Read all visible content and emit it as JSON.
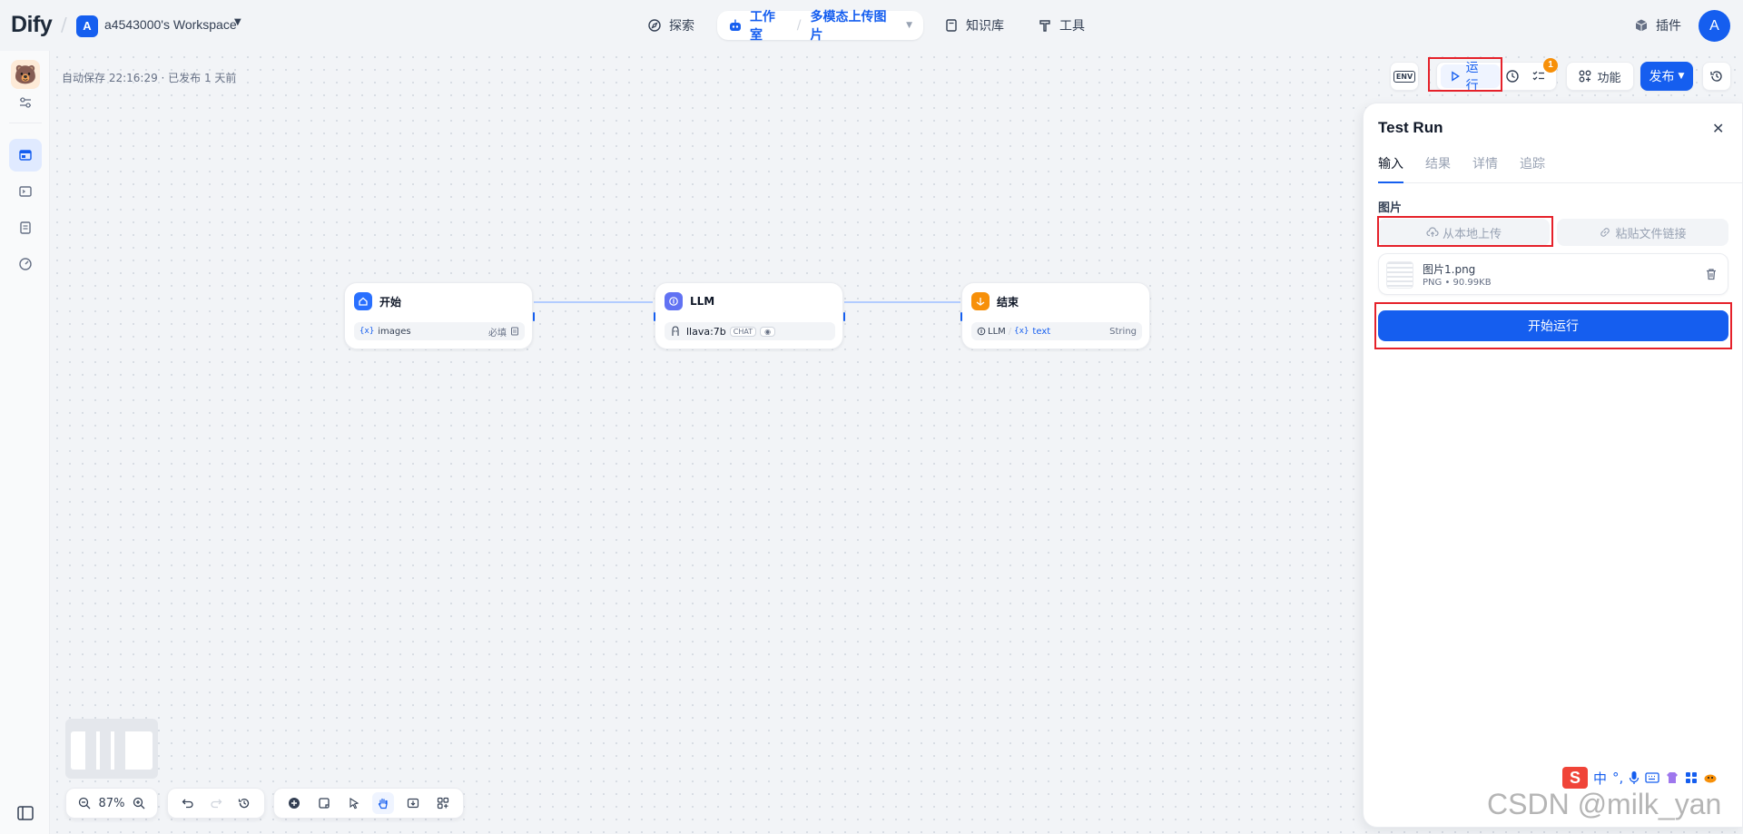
{
  "header": {
    "logo": "Dify",
    "workspace_initial": "A",
    "workspace_name": "a4543000's Workspace",
    "nav": {
      "explore": "探索",
      "studio": "工作室",
      "app_name": "多模态上传图片",
      "knowledge": "知识库",
      "tools": "工具"
    },
    "plugins": "插件",
    "user_initial": "A"
  },
  "canvas": {
    "autosave": "自动保存 22:16:29 · 已发布 1 天前",
    "toolbar": {
      "env": "ENV",
      "run": "运行",
      "checklist_badge": "1",
      "features": "功能",
      "publish": "发布"
    },
    "nodes": [
      {
        "title": "开始",
        "var_prefix": "{x}",
        "var": "images",
        "right": "必填",
        "color": "#2970ff"
      },
      {
        "title": "LLM",
        "model": "llava:7b",
        "mode": "CHAT",
        "color": "#6172f3"
      },
      {
        "title": "结束",
        "source": "LLM",
        "var_prefix": "{x}",
        "var": "text",
        "right": "String",
        "color": "#f79009"
      }
    ],
    "zoom": "87%"
  },
  "test_run": {
    "title": "Test Run",
    "tabs": [
      "输入",
      "结果",
      "详情",
      "追踪"
    ],
    "field_label": "图片",
    "upload_local": "从本地上传",
    "paste_link": "粘贴文件链接",
    "file": {
      "name": "图片1.png",
      "meta": "PNG • 90.99KB"
    },
    "start_button": "开始运行"
  },
  "ime": {
    "mode": "中",
    "punct": "°,"
  },
  "watermark": "CSDN @milk_yan",
  "colors": {
    "accent": "#155eef",
    "highlight": "#e5212a"
  }
}
